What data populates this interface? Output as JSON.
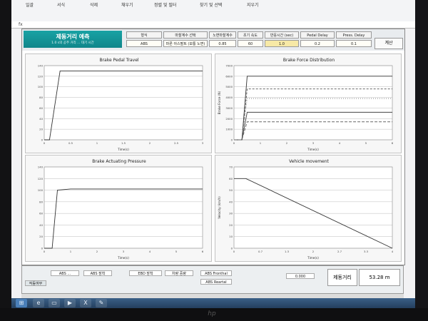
{
  "excel": {
    "ribbon_buttons": [
      "일괄",
      "서식",
      "삭제",
      "채우기",
      "정렬 및 필터",
      "찾기 및 선택",
      "지우기"
    ],
    "formula_hint": "fx"
  },
  "sheet": {
    "title": "제동거리 예측",
    "subtitle": "1.0 s의 공주 거리 ... 대기 시간",
    "header_cells": [
      {
        "label": "형식",
        "value": "ABS"
      },
      {
        "label": "마찰계수 선택",
        "value": "마른 아스팔트 (보통 노면)"
      },
      {
        "label": "노면마찰계수",
        "value": "0.85"
      },
      {
        "label": "초기 속도",
        "value": "60"
      },
      {
        "label": "반응시간 (sec)",
        "value": "1.0"
      },
      {
        "label": "Pedal Delay",
        "value": "0.2"
      },
      {
        "label": "Press. Delay",
        "value": "0.1"
      }
    ],
    "calc_label": "계산"
  },
  "chart_data": [
    {
      "type": "line",
      "title": "Brake Pedal Travel",
      "xlabel": "Time(s)",
      "ylabel": "",
      "ylim": [
        0,
        140
      ],
      "xlim": [
        0,
        3
      ],
      "x": [
        0,
        0.1,
        0.3,
        1,
        2,
        3
      ],
      "series": [
        {
          "values": [
            0,
            0,
            130,
            130,
            130,
            130
          ]
        }
      ]
    },
    {
      "type": "line",
      "title": "Brake Force Distribution",
      "xlabel": "Time(s)",
      "ylabel": "Brake Force (N)",
      "ylim": [
        0,
        7000
      ],
      "xlim": [
        0,
        6
      ],
      "x": [
        0,
        0.3,
        0.5,
        1,
        6
      ],
      "series": [
        {
          "values": [
            0,
            0,
            6000,
            6000,
            6000
          ]
        },
        {
          "values": [
            0,
            0,
            4800,
            4800,
            4800
          ]
        },
        {
          "values": [
            0,
            0,
            3900,
            3900,
            3900
          ]
        },
        {
          "values": [
            0,
            0,
            2600,
            2600,
            2600
          ]
        },
        {
          "values": [
            0,
            0,
            1700,
            1700,
            1700
          ]
        }
      ]
    },
    {
      "type": "line",
      "title": "Brake Actuating Pressure",
      "xlabel": "Time(s)",
      "ylabel": "",
      "ylim": [
        0,
        140
      ],
      "xlim": [
        0,
        6
      ],
      "x": [
        0,
        0.3,
        0.5,
        1,
        6
      ],
      "series": [
        {
          "values": [
            0,
            0,
            100,
            102,
            102
          ]
        }
      ]
    },
    {
      "type": "line",
      "title": "Vehicle movement",
      "xlabel": "Time(s)",
      "ylabel": "Velocity (km/h)",
      "ylim": [
        0,
        70
      ],
      "xlim": [
        0,
        4
      ],
      "x": [
        0,
        0.3,
        4
      ],
      "series": [
        {
          "values": [
            60,
            60,
            0
          ]
        }
      ]
    }
  ],
  "footer": {
    "cells": [
      "작동여부",
      "ABS ...",
      "ABS 장착",
      "EBD 장착",
      "차량 중량",
      "ABS Fronthal",
      "ABS Reartal",
      "0.000"
    ],
    "result_label": "제동거리",
    "result_value": "53.28 m"
  },
  "taskbar": {
    "icons": [
      "start-orb",
      "ie-icon",
      "folder-icon",
      "media-icon",
      "excel-icon",
      "paint-icon"
    ]
  }
}
